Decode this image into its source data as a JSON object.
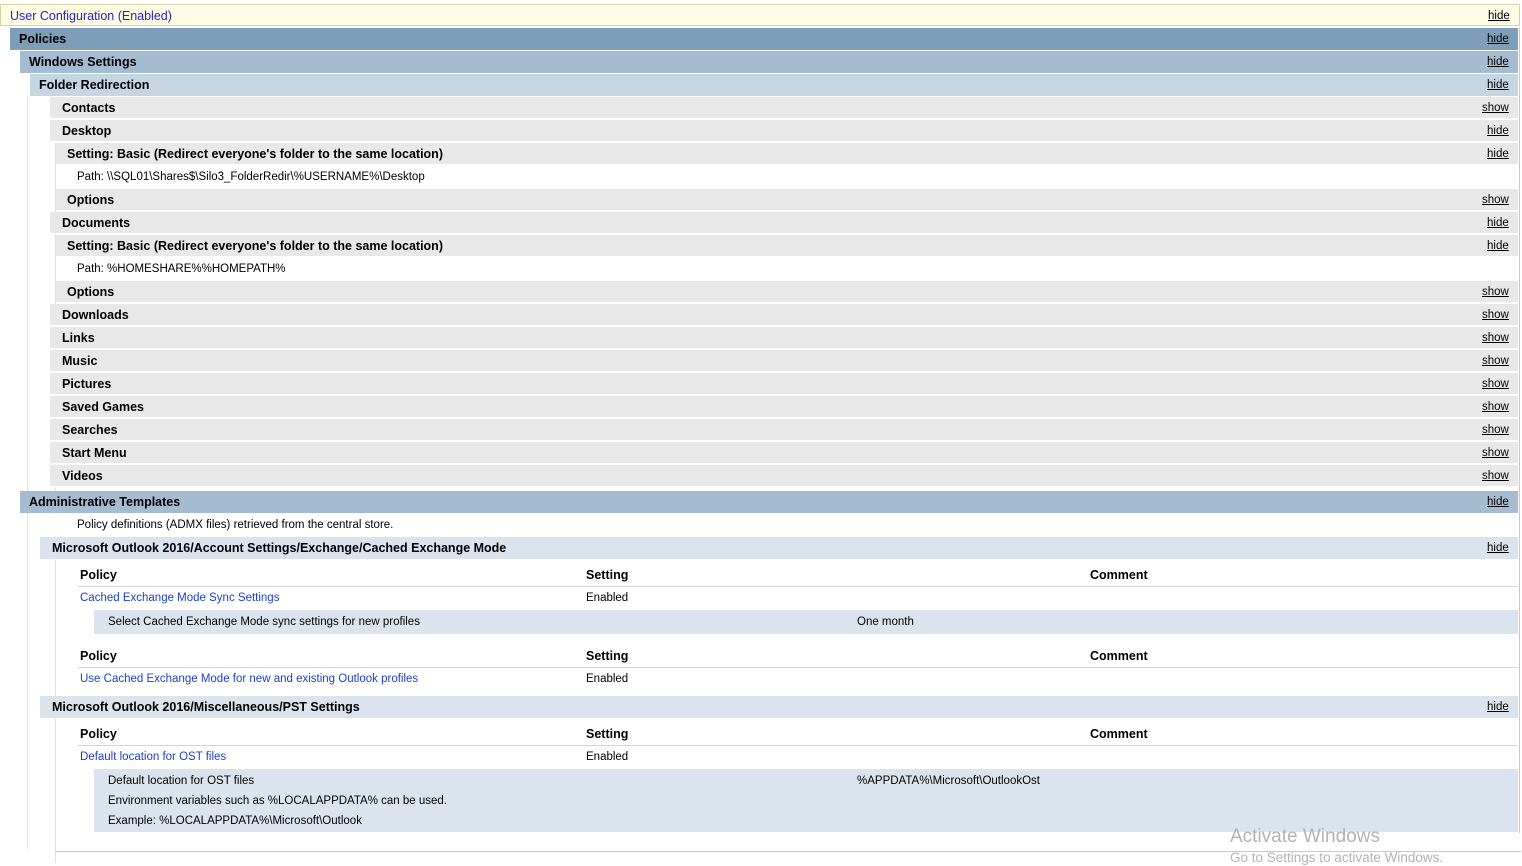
{
  "window": {
    "hide": "hide",
    "show": "show"
  },
  "user_config": {
    "title": "User Configuration (Enabled)",
    "toggle": "hide"
  },
  "policies": {
    "title": "Policies",
    "toggle": "hide"
  },
  "windows_settings": {
    "title": "Windows Settings",
    "toggle": "hide"
  },
  "folder_redirection": {
    "title": "Folder Redirection",
    "toggle": "hide",
    "contacts": {
      "title": "Contacts",
      "toggle": "show"
    },
    "desktop": {
      "title": "Desktop",
      "toggle": "hide",
      "setting": "Setting: Basic (Redirect everyone's folder to the same location)",
      "setting_toggle": "hide",
      "path": "Path: \\\\SQL01\\Shares$\\Silo3_FolderRedir\\%USERNAME%\\Desktop",
      "options": "Options",
      "options_toggle": "show"
    },
    "documents": {
      "title": "Documents",
      "toggle": "hide",
      "setting": "Setting: Basic (Redirect everyone's folder to the same location)",
      "setting_toggle": "hide",
      "path": "Path: %HOMESHARE%%HOMEPATH%",
      "options": "Options",
      "options_toggle": "show"
    },
    "folders": [
      {
        "title": "Downloads",
        "toggle": "show"
      },
      {
        "title": "Links",
        "toggle": "show"
      },
      {
        "title": "Music",
        "toggle": "show"
      },
      {
        "title": "Pictures",
        "toggle": "show"
      },
      {
        "title": "Saved Games",
        "toggle": "show"
      },
      {
        "title": "Searches",
        "toggle": "show"
      },
      {
        "title": "Start Menu",
        "toggle": "show"
      },
      {
        "title": "Videos",
        "toggle": "show"
      }
    ]
  },
  "admin_templates": {
    "title": "Administrative Templates",
    "toggle": "hide",
    "note": "Policy definitions (ADMX files) retrieved from the central store.",
    "headers": {
      "policy": "Policy",
      "setting": "Setting",
      "comment": "Comment"
    },
    "categories": [
      {
        "title": "Microsoft Outlook 2016/Account Settings/Exchange/Cached Exchange Mode",
        "toggle": "hide",
        "policies": [
          {
            "name": "Cached Exchange Mode Sync Settings",
            "setting": "Enabled",
            "detail_label": "Select Cached Exchange Mode sync settings for new profiles",
            "detail_value": "One month"
          },
          {
            "name": "Use Cached Exchange Mode for new and existing Outlook profiles",
            "setting": "Enabled"
          }
        ]
      },
      {
        "title": "Microsoft Outlook 2016/Miscellaneous/PST Settings",
        "toggle": "hide",
        "policies": [
          {
            "name": "Default location for OST files",
            "setting": "Enabled",
            "detail_label": "Default location for OST files",
            "detail_value": "%APPDATA%\\Microsoft\\OutlookOst",
            "detail_extra1": "Environment variables such as %LOCALAPPDATA% can be used.",
            "detail_extra2": "Example: %LOCALAPPDATA%\\Microsoft\\Outlook"
          }
        ]
      }
    ]
  },
  "watermark": {
    "line1": "Activate Windows",
    "line2": "Go to Settings to activate Windows."
  }
}
